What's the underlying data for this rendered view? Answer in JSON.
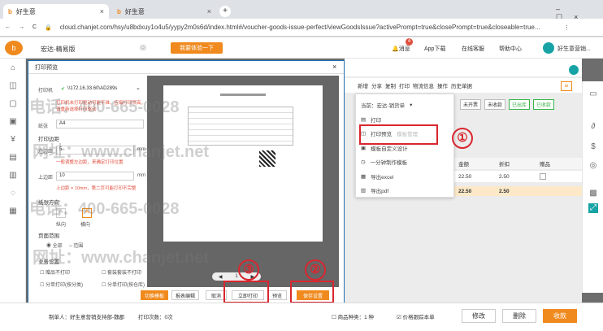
{
  "tabs": [
    {
      "label": "好生意",
      "active": true
    },
    {
      "label": "好生意",
      "active": false
    }
  ],
  "address": "cloud.chanjet.com/hsy/u8bdxuy1o4u5/yypy2m0s6d/index.html#/voucher-goods-issue-perfect/viewGoodsIssue?activePrompt=true&closePrompt=true&closeable=true...",
  "appbar": {
    "company": "宏达-精易版",
    "trial_btn": "我要体验一下",
    "message": "消息",
    "message_badge": "4",
    "app_download": "App下载",
    "online_service": "在线客服",
    "help": "帮助中心",
    "user": "好生意营销..."
  },
  "dialog": {
    "title": "打印预览",
    "printer_label": "打印机",
    "printer_value": "\\\\172.16.33.60\\AD289s",
    "printer_warning": "打印机未打印驱动可能不准，应每打印页高，请重新选择打印驱动",
    "paper_label": "纸张",
    "paper_value": "A4",
    "margin_header": "打印边距",
    "left_label": "左边距",
    "left_value": "5",
    "unit": "mm",
    "left_hint": "一般调整左边距，来确定打印位置",
    "top_label": "上边距",
    "top_value": "10",
    "top_hint": "上边距 = 10mm，第二页可能打印不完整",
    "orientation_header": "纸张方向",
    "portrait": "纵向",
    "landscape": "横向",
    "range_header": "页面范围",
    "all": "全部",
    "range": "范围",
    "other_header": "业务设置",
    "opt1": "赠品不打印",
    "opt2": "套装套装不打印",
    "opt3": "分单打印(按分类)",
    "opt4": "分单打印(按仓库)",
    "btn_template": "切换模板",
    "btn_edit": "报表编辑",
    "btn_cancel": "取消",
    "btn_print_now": "立即打印",
    "btn_preview": "预览",
    "btn_save": "保存设置",
    "page_nav": "1"
  },
  "menu": {
    "header": "当前：宏达-销货单",
    "items": [
      "打印",
      "打印预览",
      "模板自定义设计",
      "一分钟制作模板",
      "导出excel",
      "导出pdf"
    ],
    "side_label": "模板管理"
  },
  "toolbar": [
    "新增",
    "分享",
    "复制",
    "打印",
    "物流信息",
    "操作",
    "历史单据"
  ],
  "status_chips": [
    "未开票",
    "未收款",
    "已出库",
    "已收款"
  ],
  "table": {
    "headers": [
      "金额",
      "折扣",
      "赠品"
    ],
    "row1": [
      "22.50",
      "2.50",
      ""
    ],
    "total": [
      "22.50",
      "2.50"
    ]
  },
  "annotations": [
    "①",
    "②",
    "③"
  ],
  "footer": {
    "creator": "制单人：好生意营销支持部-魏郡",
    "print_count": "打印次数：0次",
    "goods_kind": "商品种类：1 种",
    "price_track": "价格跟踪本单",
    "edit": "修改",
    "delete": "删除",
    "receipt": "收款"
  },
  "watermark": [
    "电话：400-665-0028",
    "网址：www.chanjet.net"
  ],
  "colors": {
    "accent": "#f08a1e",
    "teal": "#17a3a5",
    "red": "#d9262f",
    "green": "#3bb54a"
  }
}
